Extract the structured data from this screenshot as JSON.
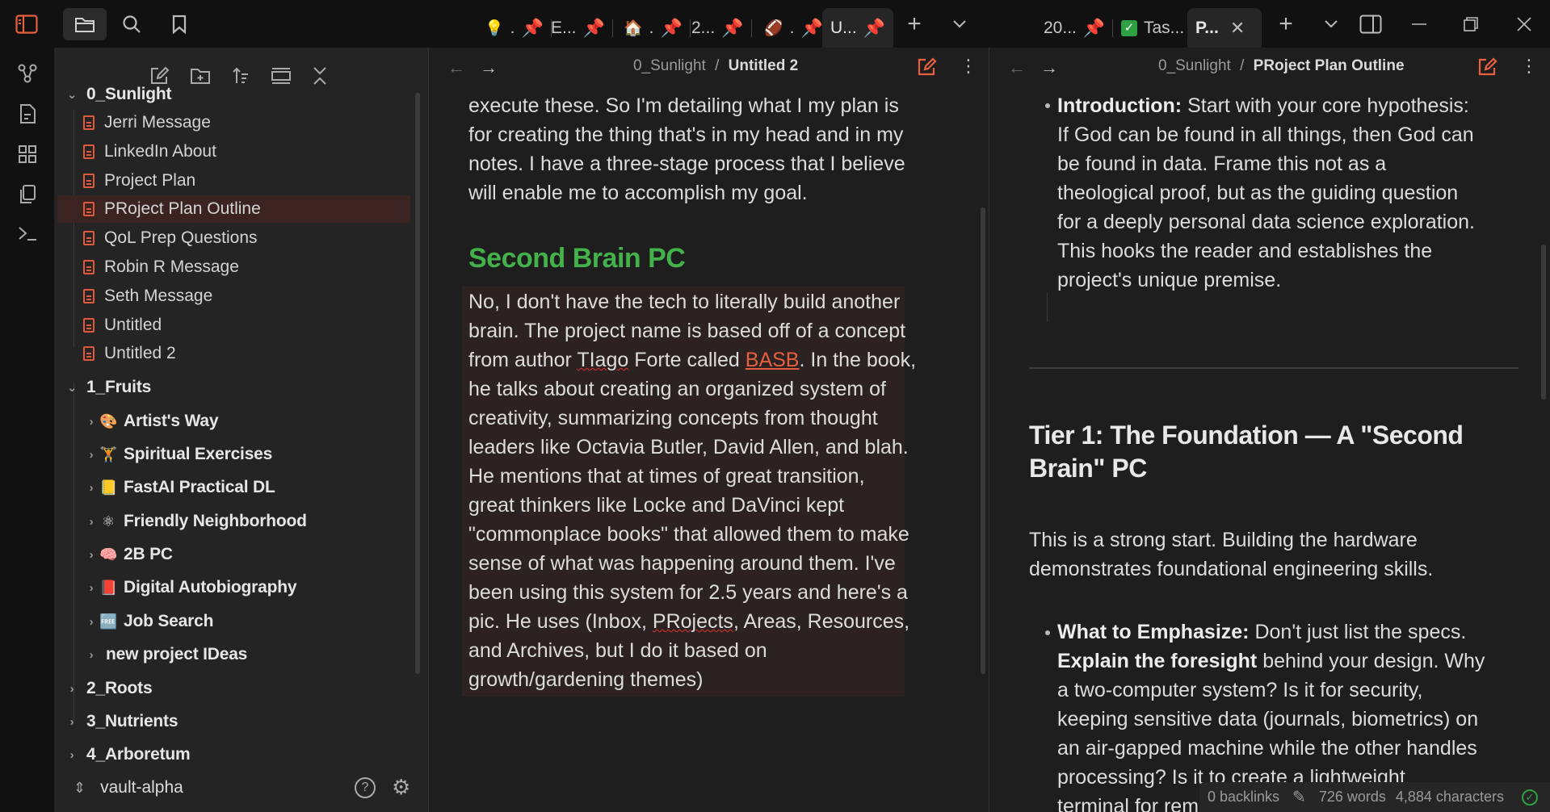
{
  "tabs": {
    "left": [
      {
        "label": ".",
        "emoji": "💡"
      },
      {
        "label": "E..."
      },
      {
        "label": ".",
        "emoji": "🏠"
      },
      {
        "label": "2..."
      },
      {
        "label": ".",
        "emoji": "🏈"
      },
      {
        "label": "U..."
      }
    ],
    "right": [
      {
        "label": "20..."
      },
      {
        "label": "Tas..."
      },
      {
        "label": "P..."
      }
    ]
  },
  "sidebar": {
    "vault_name": "vault-alpha",
    "folders": [
      {
        "name": "0_Sunlight",
        "files": [
          "Jerri Message",
          "LinkedIn About",
          "Project Plan",
          "PRoject Plan Outline",
          "QoL Prep Questions",
          "Robin R Message",
          "Seth Message",
          "Untitled",
          "Untitled 2"
        ]
      },
      {
        "name": "1_Fruits",
        "subfolders": [
          {
            "emoji": "🎨",
            "name": "Artist's Way"
          },
          {
            "emoji": "🏋",
            "name": "Spiritual Exercises"
          },
          {
            "emoji": "📒",
            "name": "FastAI Practical DL"
          },
          {
            "emoji": "⚛",
            "name": "Friendly Neighborhood"
          },
          {
            "emoji": "🧠",
            "name": "2B PC"
          },
          {
            "emoji": "📕",
            "name": "Digital Autobiography"
          },
          {
            "emoji": "🆓",
            "name": "Job Search"
          },
          {
            "emoji": "",
            "name": "new project IDeas"
          }
        ]
      },
      {
        "name": "2_Roots"
      },
      {
        "name": "3_Nutrients"
      },
      {
        "name": "4_Arboretum"
      }
    ]
  },
  "left_pane": {
    "crumb_folder": "0_Sunlight",
    "crumb_sep": "/",
    "crumb_file": "Untitled 2",
    "intro_lines": [
      "execute these. So I'm detailing what I my plan is",
      "for creating the thing that's in my head and in my",
      "notes. I have a three-stage process that I believe",
      "will enable me to accomplish my goal."
    ],
    "heading": "Second Brain PC",
    "para": {
      "l1": "No, I don't have the tech to literally build another",
      "l2": "brain. The project name is based off of a concept",
      "l3a": "from author ",
      "l3b": "TIago",
      "l3c": " Forte called ",
      "l3d": "BASB",
      "l3e": ". In the book,",
      "l4": "he talks about creating an organized system of",
      "l5": "creativity, summarizing concepts from thought",
      "l6": "leaders like Octavia Butler, David Allen, and blah.",
      "l7": "He mentions that at times of great transition,",
      "l8": "great thinkers like Locke and DaVinci kept",
      "l9": "\"commonplace books\" that allowed them to make",
      "l10": "sense of what was happening around them. I've",
      "l11": "been using this system for 2.5 years and here's a",
      "l12a": "pic. He uses (Inbox, ",
      "l12b": "PRojects",
      "l12c": ", Areas, Resources,",
      "l13": "and Archives, but I do it based on",
      "l14": "growth/gardening themes)"
    }
  },
  "right_pane": {
    "crumb_folder": "0_Sunlight",
    "crumb_sep": "/",
    "crumb_file": "PRoject Plan Outline",
    "intro_bold": "Introduction:",
    "intro_lines": [
      " Start with your core hypothesis:",
      "If God can be found in all things, then God can",
      "be found in data. Frame this not as a",
      "theological proof, but as the guiding question",
      "for a deeply personal data science exploration.",
      "This hooks the reader and establishes the",
      "project's unique premise."
    ],
    "tier_heading_l1": "Tier 1: The Foundation — A \"Second",
    "tier_heading_l2": "Brain\" PC",
    "tier_para_l1": "This is a strong start. Building the hardware",
    "tier_para_l2": "demonstrates foundational engineering skills.",
    "emph_bold": "What to Emphasize:",
    "emph_rest": " Don't just list the specs.",
    "explain_bold": "Explain the foresight",
    "explain_rest": " behind your design. Why",
    "lines": [
      "a two-computer system? Is it for security,",
      "keeping sensitive data (journals, biometrics) on",
      "an air-gapped machine while the other handles",
      "processing? Is it to create a lightweight",
      "terminal for rem"
    ]
  },
  "status": {
    "backlinks": "0 backlinks",
    "words": "726 words",
    "chars": "4,884 characters"
  },
  "colors": {
    "accent": "#e6603f",
    "heading_green": "#44b24a",
    "check_green": "#2ea043"
  }
}
